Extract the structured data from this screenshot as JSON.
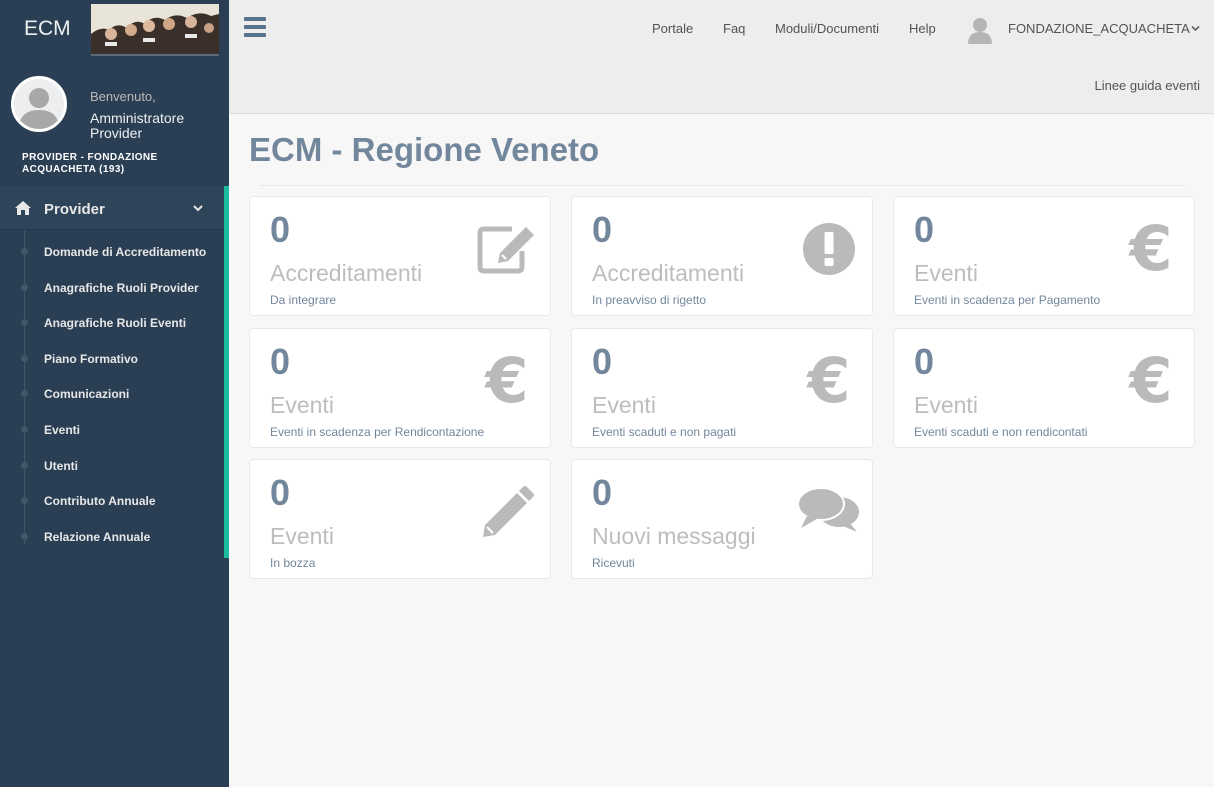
{
  "sidebar": {
    "brand": "ECM",
    "welcome": "Benvenuto,",
    "username": "Amministratore Provider",
    "provider": "PROVIDER - FONDAZIONE ACQUACHETA (193)",
    "menu_title": "Provider",
    "items": [
      {
        "label": "Domande di Accreditamento"
      },
      {
        "label": "Anagrafiche Ruoli Provider"
      },
      {
        "label": "Anagrafiche Ruoli Eventi"
      },
      {
        "label": "Piano Formativo"
      },
      {
        "label": "Comunicazioni"
      },
      {
        "label": "Eventi"
      },
      {
        "label": "Utenti"
      },
      {
        "label": "Contributo Annuale"
      },
      {
        "label": "Relazione Annuale"
      }
    ]
  },
  "topnav": {
    "links": [
      "Portale",
      "Faq",
      "Moduli/Documenti",
      "Help"
    ],
    "user": "FONDAZIONE_ACQUACHETA",
    "guide": "Linee guida eventi"
  },
  "main": {
    "title": "ECM - Regione Veneto",
    "tiles": [
      {
        "count": "0",
        "title": "Accreditamenti",
        "desc": "Da integrare",
        "icon": "edit-icon"
      },
      {
        "count": "0",
        "title": "Accreditamenti",
        "desc": "In preavviso di rigetto",
        "icon": "exclamation-circle-icon"
      },
      {
        "count": "0",
        "title": "Eventi",
        "desc": "Eventi in scadenza per Pagamento",
        "icon": "euro-icon"
      },
      {
        "count": "0",
        "title": "Eventi",
        "desc": "Eventi in scadenza per Rendicontazione",
        "icon": "euro-icon"
      },
      {
        "count": "0",
        "title": "Eventi",
        "desc": "Eventi scaduti e non pagati",
        "icon": "euro-icon"
      },
      {
        "count": "0",
        "title": "Eventi",
        "desc": "Eventi scaduti e non rendicontati",
        "icon": "euro-icon"
      },
      {
        "count": "0",
        "title": "Eventi",
        "desc": "In bozza",
        "icon": "pencil-icon"
      },
      {
        "count": "0",
        "title": "Nuovi messaggi",
        "desc": "Ricevuti",
        "icon": "comments-icon"
      }
    ],
    "euro_symbol": "€"
  },
  "colors": {
    "sidebar": "#2a3f54",
    "accent": "#1abb9c",
    "title": "#73879c",
    "icon": "#bababa"
  }
}
